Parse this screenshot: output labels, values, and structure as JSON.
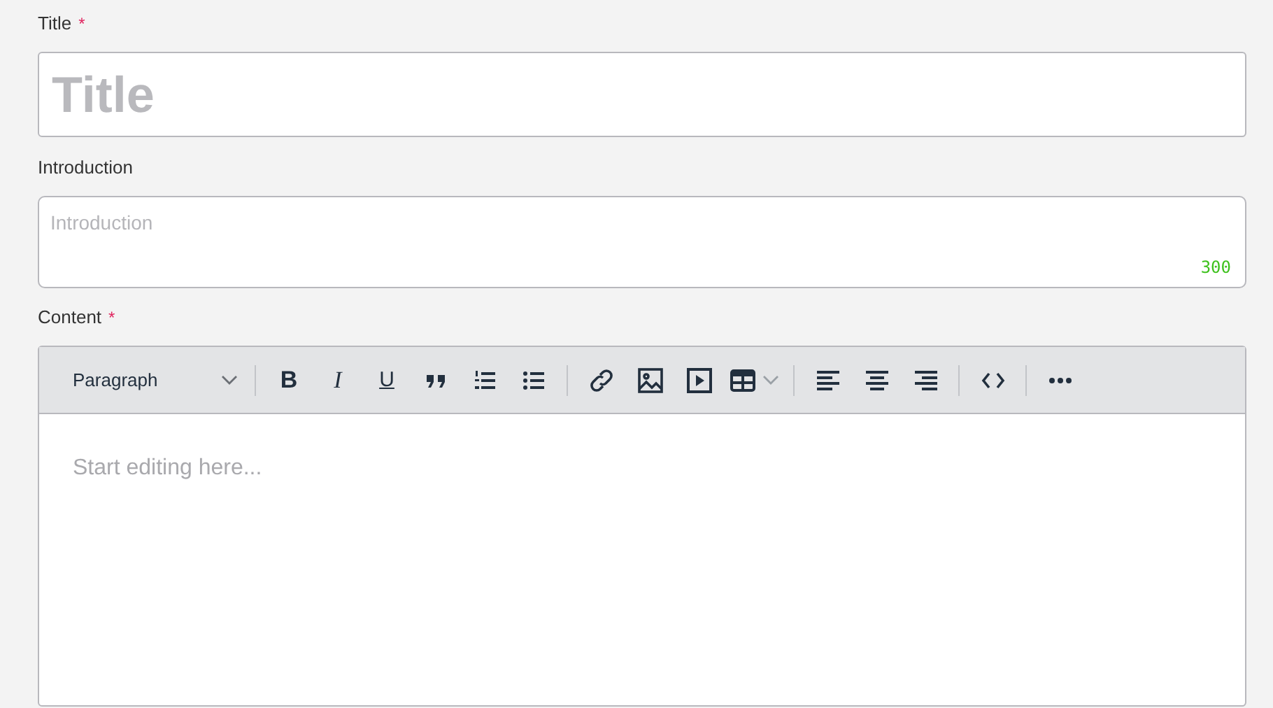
{
  "title_field": {
    "label": "Title",
    "required_mark": "*",
    "placeholder": "Title"
  },
  "introduction_field": {
    "label": "Introduction",
    "placeholder": "Introduction",
    "counter": "300"
  },
  "content_field": {
    "label": "Content",
    "required_mark": "*",
    "block_format": "Paragraph",
    "toolbar_groups": [
      [
        {
          "kind": "bold",
          "text": "B"
        },
        {
          "kind": "italic",
          "text": "I"
        },
        {
          "kind": "underline",
          "text": "U"
        },
        {
          "kind": "quote"
        },
        {
          "kind": "ordered-list"
        },
        {
          "kind": "bullet-list"
        }
      ],
      [
        {
          "kind": "link"
        },
        {
          "kind": "image"
        },
        {
          "kind": "media"
        },
        {
          "kind": "table"
        }
      ],
      [
        {
          "kind": "align-left"
        },
        {
          "kind": "align-center"
        },
        {
          "kind": "align-right"
        }
      ],
      [
        {
          "kind": "code"
        }
      ],
      [
        {
          "kind": "more"
        }
      ]
    ],
    "placeholder": "Start editing here..."
  }
}
